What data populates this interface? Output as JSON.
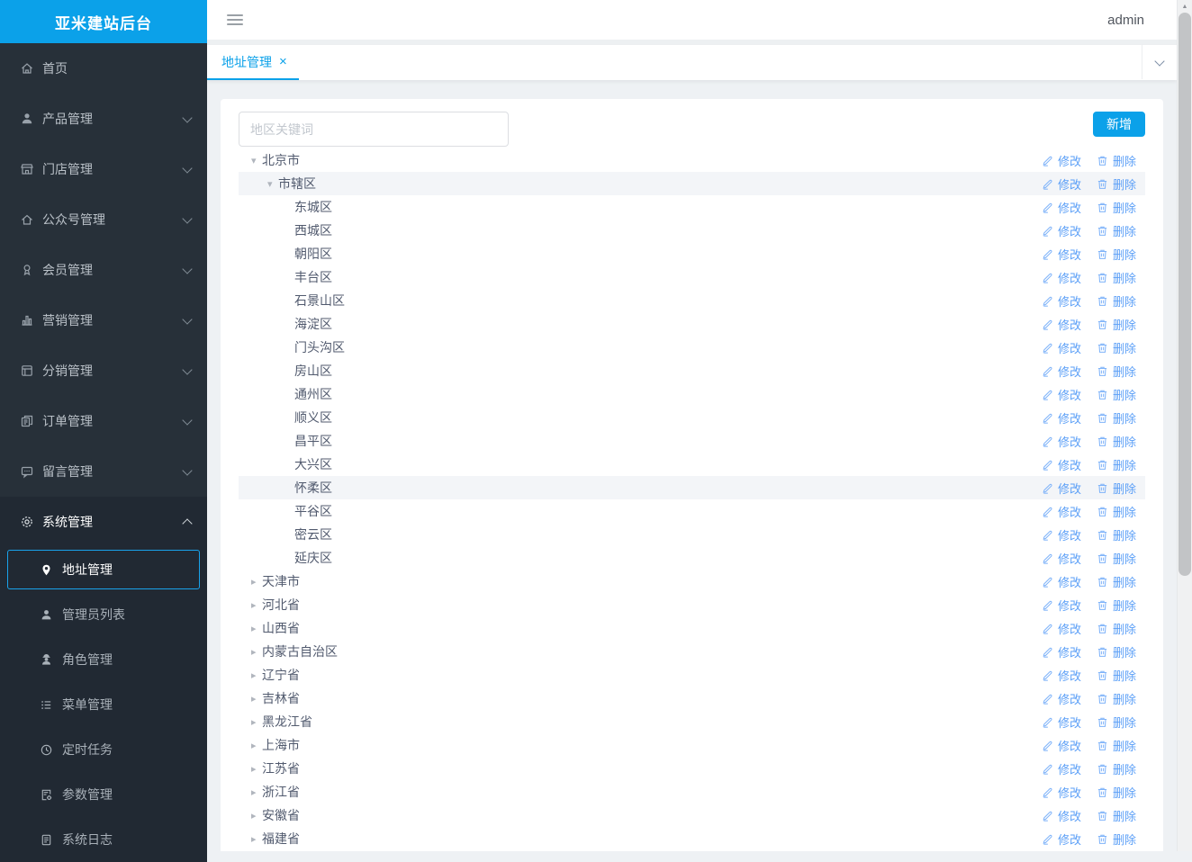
{
  "brand": {
    "title": "亚米建站后台"
  },
  "colors": {
    "accent": "#0ba1e9",
    "action_link": "#5b9ff7",
    "sidebar_bg": "#273039",
    "sidebar_group_bg": "#212933",
    "row_highlight": "#f3f5f8"
  },
  "header": {
    "username": "admin"
  },
  "tab_bar": {
    "active_tab": "地址管理",
    "close_glyph": "×"
  },
  "sidebar": {
    "items": [
      {
        "key": "home",
        "label": "首页",
        "icon": "home-icon",
        "expandable": false
      },
      {
        "key": "product",
        "label": "产品管理",
        "icon": "product-icon",
        "expandable": true
      },
      {
        "key": "store",
        "label": "门店管理",
        "icon": "store-icon",
        "expandable": true
      },
      {
        "key": "official-account",
        "label": "公众号管理",
        "icon": "official-account-icon",
        "expandable": true
      },
      {
        "key": "member",
        "label": "会员管理",
        "icon": "member-icon",
        "expandable": true
      },
      {
        "key": "marketing",
        "label": "营销管理",
        "icon": "marketing-icon",
        "expandable": true
      },
      {
        "key": "distribution",
        "label": "分销管理",
        "icon": "distribution-icon",
        "expandable": true
      },
      {
        "key": "order",
        "label": "订单管理",
        "icon": "order-icon",
        "expandable": true
      },
      {
        "key": "message",
        "label": "留言管理",
        "icon": "message-icon",
        "expandable": true
      },
      {
        "key": "system",
        "label": "系统管理",
        "icon": "gear-icon",
        "expandable": true,
        "expanded": true,
        "children": [
          {
            "key": "address",
            "label": "地址管理",
            "icon": "location-pin-icon",
            "active": true
          },
          {
            "key": "admin-list",
            "label": "管理员列表",
            "icon": "person-icon"
          },
          {
            "key": "role",
            "label": "角色管理",
            "icon": "role-person-icon"
          },
          {
            "key": "menu",
            "label": "菜单管理",
            "icon": "list-icon"
          },
          {
            "key": "schedule",
            "label": "定时任务",
            "icon": "clock-icon"
          },
          {
            "key": "params",
            "label": "参数管理",
            "icon": "doc-gear-icon"
          },
          {
            "key": "log",
            "label": "系统日志",
            "icon": "doc-icon"
          }
        ]
      }
    ]
  },
  "toolbar": {
    "search_placeholder": "地区关键词",
    "add_button": "新增"
  },
  "row_actions": {
    "edit": "修改",
    "delete": "删除"
  },
  "tree": {
    "rows": [
      {
        "label": "北京市",
        "level": 0,
        "state": "expanded"
      },
      {
        "label": "市辖区",
        "level": 1,
        "state": "expanded",
        "highlight": true
      },
      {
        "label": "东城区",
        "level": 2,
        "state": "leaf"
      },
      {
        "label": "西城区",
        "level": 2,
        "state": "leaf"
      },
      {
        "label": "朝阳区",
        "level": 2,
        "state": "leaf"
      },
      {
        "label": "丰台区",
        "level": 2,
        "state": "leaf"
      },
      {
        "label": "石景山区",
        "level": 2,
        "state": "leaf"
      },
      {
        "label": "海淀区",
        "level": 2,
        "state": "leaf"
      },
      {
        "label": "门头沟区",
        "level": 2,
        "state": "leaf"
      },
      {
        "label": "房山区",
        "level": 2,
        "state": "leaf"
      },
      {
        "label": "通州区",
        "level": 2,
        "state": "leaf"
      },
      {
        "label": "顺义区",
        "level": 2,
        "state": "leaf"
      },
      {
        "label": "昌平区",
        "level": 2,
        "state": "leaf"
      },
      {
        "label": "大兴区",
        "level": 2,
        "state": "leaf"
      },
      {
        "label": "怀柔区",
        "level": 2,
        "state": "leaf",
        "highlight": true
      },
      {
        "label": "平谷区",
        "level": 2,
        "state": "leaf"
      },
      {
        "label": "密云区",
        "level": 2,
        "state": "leaf"
      },
      {
        "label": "延庆区",
        "level": 2,
        "state": "leaf"
      },
      {
        "label": "天津市",
        "level": 0,
        "state": "collapsed"
      },
      {
        "label": "河北省",
        "level": 0,
        "state": "collapsed"
      },
      {
        "label": "山西省",
        "level": 0,
        "state": "collapsed"
      },
      {
        "label": "内蒙古自治区",
        "level": 0,
        "state": "collapsed"
      },
      {
        "label": "辽宁省",
        "level": 0,
        "state": "collapsed"
      },
      {
        "label": "吉林省",
        "level": 0,
        "state": "collapsed"
      },
      {
        "label": "黑龙江省",
        "level": 0,
        "state": "collapsed"
      },
      {
        "label": "上海市",
        "level": 0,
        "state": "collapsed"
      },
      {
        "label": "江苏省",
        "level": 0,
        "state": "collapsed"
      },
      {
        "label": "浙江省",
        "level": 0,
        "state": "collapsed"
      },
      {
        "label": "安徽省",
        "level": 0,
        "state": "collapsed"
      },
      {
        "label": "福建省",
        "level": 0,
        "state": "collapsed"
      }
    ]
  }
}
